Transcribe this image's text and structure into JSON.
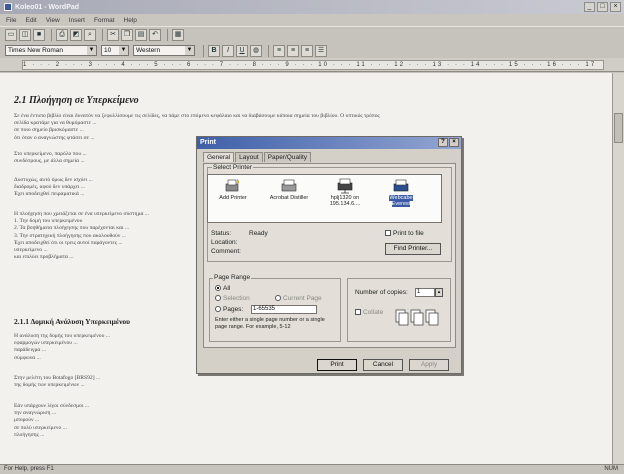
{
  "window": {
    "title": "Koleo01 - WordPad"
  },
  "menu": [
    "File",
    "Edit",
    "View",
    "Insert",
    "Format",
    "Help"
  ],
  "format_bar": {
    "font": "Times New Roman",
    "size": "10",
    "script": "Western"
  },
  "ruler_text": "1 · · · 2 · · · 3 · · · 4 · · · 5 · · · 6 · · · 7 · · · 8 · · · 9 · · · 10 · · · 11 · · · 12 · · · 13 · · · 14 · · · 15 · · · 16 · · · 17",
  "doc": {
    "heading": "2.1 Πλοήγηση σε Υπερκείμενο",
    "p1": [
      "Σε ένα έντυπο βιβλίο είναι δυνατόν να ξεφυλλίσουμε τις σελίδες, να πάμε στο επόμενο κεφάλαιο και να διαβάσουμε κάποια σημεία του βιβλίου. Ο οπτικός τρόπος",
      "σελίδα κρατάμε για να θυμόμαστε ...",
      "σε ποιο σημείο βρισκόμαστε ...",
      "ότι όταν ο αναγνώστης φτάσει σε ..."
    ],
    "p2": [
      "Στο υπερκείμενο, παρόλο που ...",
      "συνδέσμους, με άλλα σημεία ..."
    ],
    "p3": [
      "Δυστυχώς, αυτό όμως δεν ισχύει ...",
      "διαδρομές, αφού δεν υπάρχει ...",
      "Έχει αποδειχθεί πειραματικά ..."
    ],
    "p4": [
      "Η πλοήγηση που χρειάζεται σε ένα υπερκείμενο σύστημα ...",
      "1.  Την δομή του υπερκειμένου",
      "2.  Τα βοηθήματα πλοήγησης που παρέχονται και ...",
      "3.  Την στρατηγική πλοήγησης που ακολουθούν ...",
      "Έχει αποδειχθεί ότι οι τρεις αυτοί παράγοντες ...",
      "υπερκείμενο ...",
      "και επιλύει προβλήματα ..."
    ],
    "heading2": "2.1.1 Δομική Ανάλυση Υπερκειμένου",
    "p5": [
      "Η ανάλυση της δομής του υπερκειμένου ...",
      "εφαρμογών υπερκειμένου ...",
      "παράδειγμα ...",
      "σύμφωνα ..."
    ],
    "p6": [
      "Στην μελέτη του Botafogo [BRS92] ...",
      "της δομής των υπερκειμένων ..."
    ],
    "p7": [
      "Εάν υπάρχουν λίγοι σύνδεσμοι ...",
      "την αναγνώριση ...",
      "μπορούν ...",
      "σε πολύ υπερκείμενο ...",
      "πλοήγησης ..."
    ]
  },
  "print_dialog": {
    "title": "Print",
    "tabs": [
      "General",
      "Layout",
      "Paper/Quality"
    ],
    "select_printer_label": "Select Printer",
    "printers": [
      {
        "name": "Add Printer",
        "icon": "add-printer-icon"
      },
      {
        "name": "Acrobat Distiller",
        "icon": "printer-icon"
      },
      {
        "name": "hplj1320 on 195.134.6....",
        "icon": "network-printer-icon"
      },
      {
        "name": "Webcabe Everest",
        "icon": "printer-icon",
        "selected": true
      }
    ],
    "status_label": "Status:",
    "status_value": "Ready",
    "location_label": "Location:",
    "comment_label": "Comment:",
    "print_to_file": "Print to file",
    "find_printer": "Find Printer...",
    "page_range": {
      "label": "Page Range",
      "all": "All",
      "selection": "Selection",
      "current": "Current Page",
      "pages": "Pages:",
      "pages_value": "1-65535",
      "hint": "Enter either a single page number or a single page range. For example, 5-12"
    },
    "copies_label": "Number of copies:",
    "copies_value": "1",
    "collate": "Collate",
    "buttons": {
      "print": "Print",
      "cancel": "Cancel",
      "apply": "Apply"
    }
  },
  "status_bar": {
    "help": "For Help, press F1",
    "num": "NUM"
  }
}
